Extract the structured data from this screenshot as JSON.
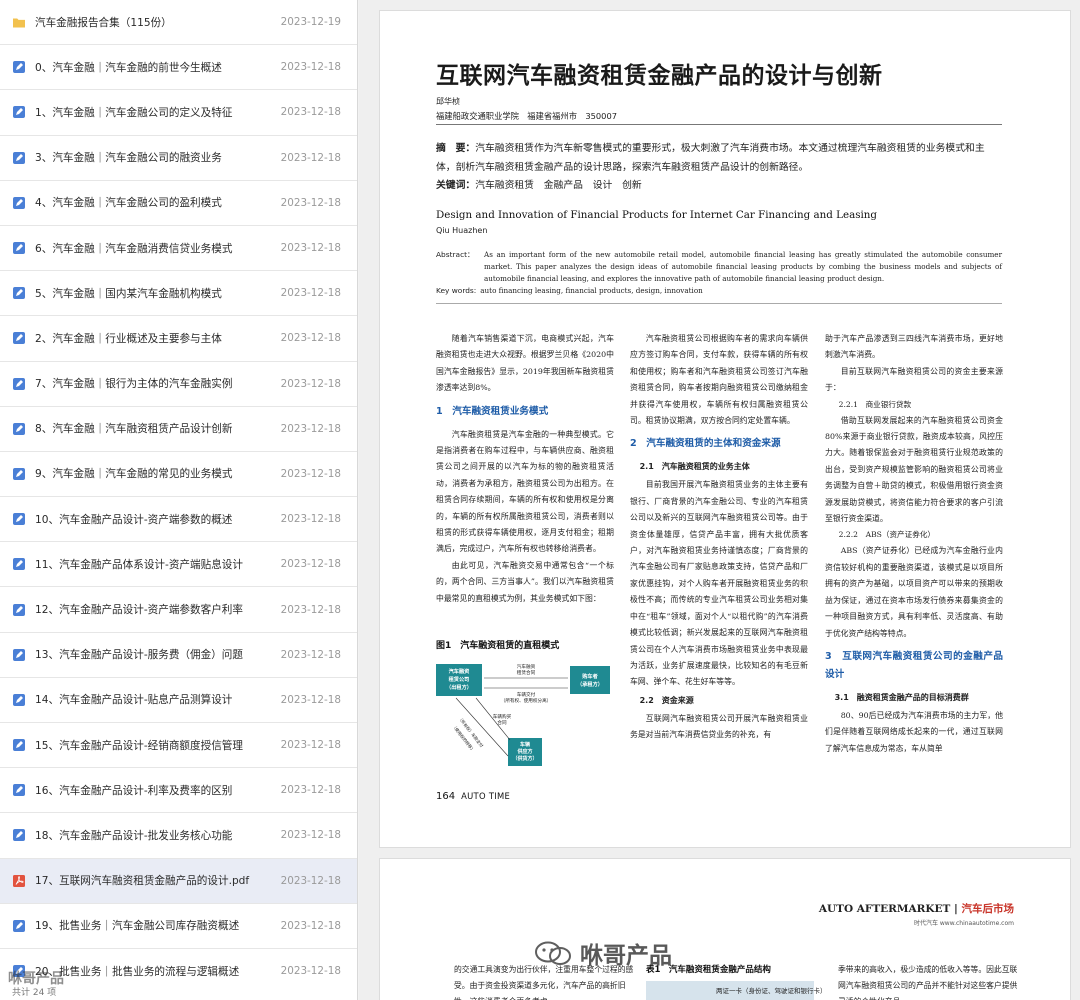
{
  "sidebar": {
    "items": [
      {
        "name": "汽车金融报告合集（115份）",
        "date": "2023-12-19",
        "type": "folder"
      },
      {
        "name": "0、汽车金融｜汽车金融的前世今生概述",
        "date": "2023-12-18",
        "type": "doc"
      },
      {
        "name": "1、汽车金融｜汽车金融公司的定义及特征",
        "date": "2023-12-18",
        "type": "doc"
      },
      {
        "name": "3、汽车金融｜汽车金融公司的融资业务",
        "date": "2023-12-18",
        "type": "doc"
      },
      {
        "name": "4、汽车金融｜汽车金融公司的盈利模式",
        "date": "2023-12-18",
        "type": "doc"
      },
      {
        "name": "6、汽车金融｜汽车金融消费信贷业务模式",
        "date": "2023-12-18",
        "type": "doc"
      },
      {
        "name": "5、汽车金融｜国内某汽车金融机构模式",
        "date": "2023-12-18",
        "type": "doc"
      },
      {
        "name": "2、汽车金融｜行业概述及主要参与主体",
        "date": "2023-12-18",
        "type": "doc"
      },
      {
        "name": "7、汽车金融｜银行为主体的汽车金融实例",
        "date": "2023-12-18",
        "type": "doc"
      },
      {
        "name": "8、汽车金融｜汽车融资租赁产品设计创新",
        "date": "2023-12-18",
        "type": "doc"
      },
      {
        "name": "9、汽车金融｜汽车金融的常见的业务模式",
        "date": "2023-12-18",
        "type": "doc"
      },
      {
        "name": "10、汽车金融产品设计-资产端参数的概述",
        "date": "2023-12-18",
        "type": "doc"
      },
      {
        "name": "11、汽车金融产品体系设计-资产端贴息设计",
        "date": "2023-12-18",
        "type": "doc"
      },
      {
        "name": "12、汽车金融产品设计-资产端参数客户利率",
        "date": "2023-12-18",
        "type": "doc"
      },
      {
        "name": "13、汽车金融产品设计-服务费（佣金）问题",
        "date": "2023-12-18",
        "type": "doc"
      },
      {
        "name": "14、汽车金融产品设计-贴息产品测算设计",
        "date": "2023-12-18",
        "type": "doc"
      },
      {
        "name": "15、汽车金融产品设计-经销商额度授信管理",
        "date": "2023-12-18",
        "type": "doc"
      },
      {
        "name": "16、汽车金融产品设计-利率及费率的区别",
        "date": "2023-12-18",
        "type": "doc"
      },
      {
        "name": "18、汽车金融产品设计-批发业务核心功能",
        "date": "2023-12-18",
        "type": "doc"
      },
      {
        "name": "17、互联网汽车融资租赁金融产品的设计.pdf",
        "date": "2023-12-18",
        "type": "pdf",
        "selected": true
      },
      {
        "name": "19、批售业务｜汽车金融公司库存融资概述",
        "date": "2023-12-18",
        "type": "doc"
      },
      {
        "name": "20、批售业务｜批售业务的流程与逻辑概述",
        "date": "2023-12-18",
        "type": "doc"
      }
    ],
    "footer": "共计 24 项"
  },
  "page1": {
    "title": "互联网汽车融资租赁金融产品的设计与创新",
    "author": "邱华桢",
    "affiliation": "福建船政交通职业学院　福建省福州市　350007",
    "abstract_label": "摘　要：",
    "abstract_text": "汽车融资租赁作为汽车新零售模式的重要形式，极大刺激了汽车消费市场。本文通过梳理汽车融资租赁的业务模式和主体，剖析汽车融资租赁金融产品的设计思路，探索汽车融资租赁产品设计的创新路径。",
    "keywords_label": "关键词：",
    "keywords_text": "汽车融资租赁　金融产品　设计　创新",
    "en_title": "Design and Innovation of Financial Products for Internet Car Financing and Leasing",
    "en_author": "Qiu Huazhen",
    "en_abstract_label": "Abstract：",
    "en_abstract_text": "As an important form of the new automobile retail model, automobile financial leasing has greatly stimulated the automobile consumer market. This paper analyzes the design ideas of automobile financial leasing products by combing the business models and subjects of automobile financial leasing, and explores the innovative path of automobile financial leasing product design.",
    "en_keywords_label": "Key words:",
    "en_keywords_text": "auto financing leasing, financial products, design, innovation",
    "col1_p1": "随着汽车销售渠道下沉，电商模式兴起，汽车融资租赁也走进大众视野。根据罗兰贝格《2020中国汽车金融报告》显示，2019年我国新车融资租赁渗透率达到8%。",
    "col1_h1": "1　汽车融资租赁业务模式",
    "col1_p2": "汽车融资租赁是汽车金融的一种典型模式。它是指消费者在购车过程中，与车辆供应商、融资租赁公司之间开展的以汽车为标的物的融资租赁活动，消费者为承租方，融资租赁公司为出租方。在租赁合同存续期间，车辆的所有权和使用权是分离的，车辆的所有权所属融资租赁公司，消费者则以租赁的形式获得车辆使用权，逐月支付租金；租期满后，完成过户，汽车所有权也转移给消费者。",
    "col1_p3": "由此可见，汽车融资交易中通常包含“一个标的，两个合同、三方当事人”。我们以汽车融资租赁中最常见的直租模式为例，其业务模式如下图：",
    "fig_caption": "图1　汽车融资租赁的直租模式",
    "diagram": {
      "lessor": "汽车融资租赁公司（出租方）",
      "lessee": "购车者（承租方）",
      "supplier": "车辆供应方（供货方）",
      "lease_contract": "汽车融资租赁合同",
      "delivery": "车辆交付（所有权、使用权分离）",
      "purchase": "车辆购买合同",
      "ownership": "（所有权）车款支付（使用权的转移）"
    },
    "col2_p1": "汽车融资租赁公司根据购车者的需求向车辆供应方签订购车合同，支付车款，获得车辆的所有权和使用权；购车者和汽车融资租赁公司签订汽车融资租赁合同，购车者按期向融资租赁公司缴纳租金并获得汽车使用权，车辆所有权归属融资租赁公司。租赁协议期满，双方按合同约定处置车辆。",
    "col2_h1": "2　汽车融资租赁的主体和资金来源",
    "col2_h2": "2.1　汽车融资租赁的业务主体",
    "col2_p2": "目前我国开展汽车融资租赁业务的主体主要有银行、厂商背景的汽车金融公司、专业的汽车租赁公司以及新兴的互联网汽车融资租赁公司等。由于资金体量雄厚，信贷产品丰富，拥有大批优质客户，对汽车融资租赁业务持谨慎态度；厂商背景的汽车金融公司有厂家贴息政策支持，信贷产品和厂家优惠挂钩，对个人购车者开展融资租赁业务的积极性不高；而传统的专业汽车租赁公司业务相对集中在“租车”领域，面对个人“以租代购”的汽车消费模式比较低调；新兴发展起来的互联网汽车融资租赁公司在个人汽车消费市场融资租赁业务中表现最为活跃，业务扩展速度最快，比较知名的有毛豆新车网、弹个车、花生好车等等。",
    "col2_h3": "2.2　资金来源",
    "col2_p3": "互联网汽车融资租赁公司开展汽车融资租赁业务是对当前汽车消费信贷业务的补充，有",
    "col3_p1": "助于汽车产品渗透到三四线汽车消费市场，更好地刺激汽车消费。",
    "col3_p2": "目前互联网汽车融资租赁公司的资金主要来源于：",
    "col3_h1": "2.2.1　商业银行贷款",
    "col3_p3": "借助互联网发展起来的汽车融资租赁公司资金80%来源于商业银行贷款，融资成本较高，风控压力大。随着银保监会对于融资租赁行业规范政策的出台，受到资产规模监管影响的融资租赁公司将业务调整为自营＋助贷的模式，积极借用银行资金资源发展助贷模式，将资信能力符合要求的客户引流至银行资金渠道。",
    "col3_h2": "2.2.2　ABS（资产证券化）",
    "col3_p4": "ABS（资产证券化）已经成为汽车金融行业内资信较好机构的重要融资渠道，该模式是以项目所拥有的资产为基础，以项目资产可以带来的预期收益为保证，通过在资本市场发行债券来募集资金的一种项目融资方式，具有利率低、灵活度高、有助于优化资产结构等特点。",
    "col3_h3": "3　互联网汽车融资租赁公司的金融产品设计",
    "col3_h4": "3.1　融资租赁金融产品的目标消费群",
    "col3_p5": "80、90后已经成为汽车消费市场的主力军，他们是伴随着互联网络成长起来的一代，通过互联网了解汽车信息成为常态，车从简单",
    "page_number": "164",
    "page_label": "AUTO TIME"
  },
  "page2": {
    "brand_en": "AUTO AFTERMARKET",
    "brand_sep": " | ",
    "brand_zh": "汽车后市场",
    "url": "时代汽车 www.chinaautotime.com",
    "col1": "的交通工具演变为出行伙伴，注重用车整个过程的感受。由于资金投资渠道多元化，汽车产品的高折旧性，这些消费者会更多考虑",
    "table_title": "表1　汽车融资租赁金融产品结构",
    "table_cell": "两证一卡（身份证、驾驶证和银行卡）",
    "col3": "季带来的高收入，极少造成的低收入等等。因此互联网汽车融资租赁公司的产品并不能针对这些客户提供灵活的个性化产品"
  },
  "watermark": {
    "right": "咻哥产品",
    "left": "咻哥产品"
  },
  "colors": {
    "accent_blue": "#1f5da8",
    "selected_row": "#e9ecf5",
    "pdf_red": "#e2533f",
    "doc_blue": "#4a7fd6",
    "folder_yellow": "#f2c14e",
    "diagram_teal": "#1f8a92"
  }
}
